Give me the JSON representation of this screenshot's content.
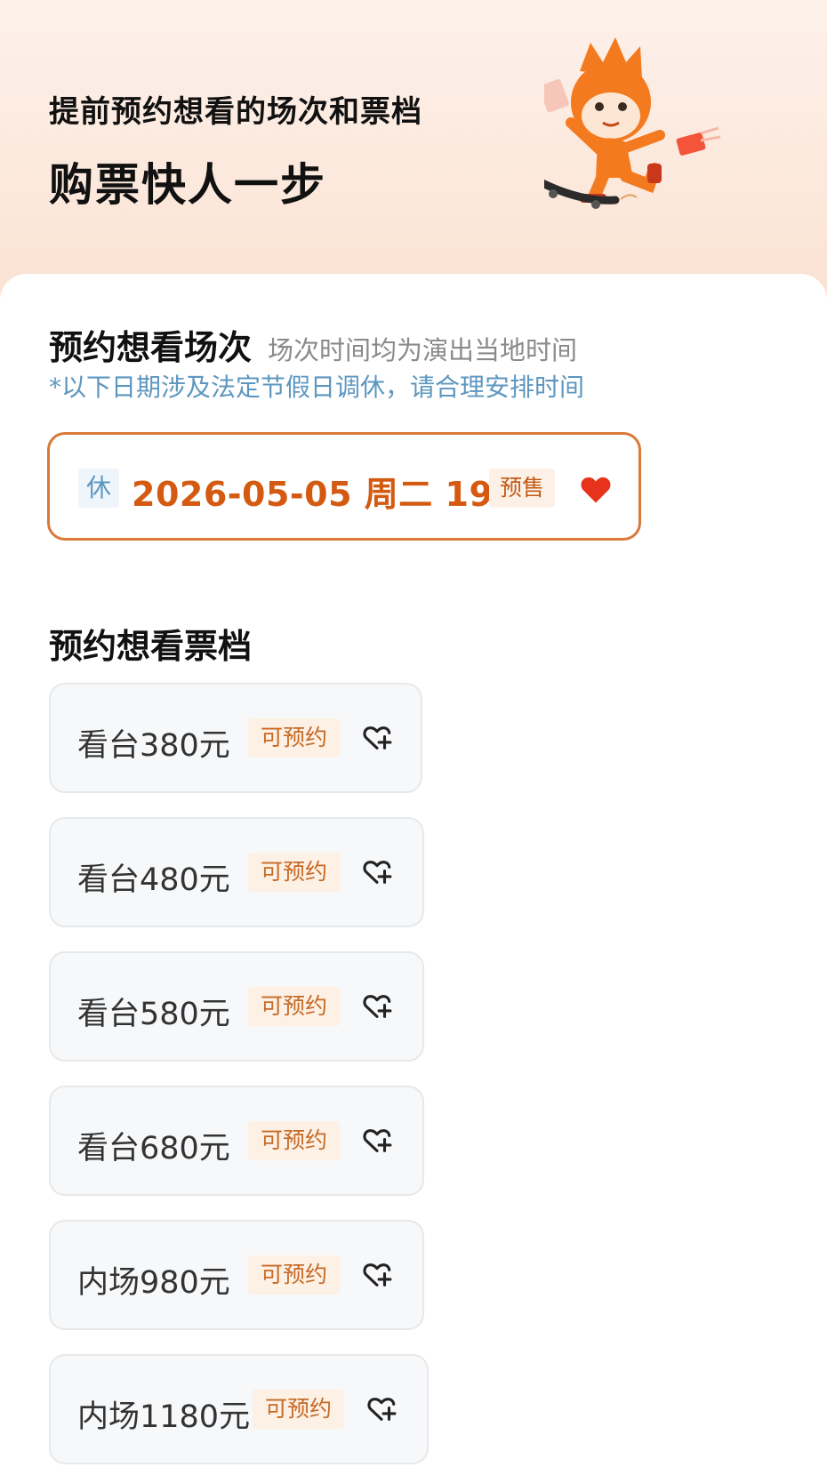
{
  "hero": {
    "line1": "提前预约想看的场次和票档",
    "line2": "购票快人一步",
    "mascot_icon": "skateboarding-mascot-icon"
  },
  "sessions_section": {
    "title": "预约想看场次",
    "subtitle": "场次时间均为演出当地时间",
    "note": "*以下日期涉及法定节假日调休，请合理安排时间",
    "selected_session": {
      "rest_badge": "休",
      "datetime": "2026-05-05 周二 19:00",
      "status_badge": "预售",
      "favorited": true
    }
  },
  "tiers_section": {
    "title": "预约想看票档",
    "tiers": [
      {
        "name": "看台380元",
        "badge": "可预约"
      },
      {
        "name": "看台480元",
        "badge": "可预约"
      },
      {
        "name": "看台580元",
        "badge": "可预约"
      },
      {
        "name": "看台680元",
        "badge": "可预约"
      },
      {
        "name": "内场980元",
        "badge": "可预约"
      },
      {
        "name": "内场1180元",
        "badge": "可预约"
      }
    ]
  },
  "colors": {
    "accent_orange": "#d45a12",
    "heart_red": "#e8331c",
    "note_blue": "#5d97c0",
    "badge_bg": "#fdf0e4"
  }
}
